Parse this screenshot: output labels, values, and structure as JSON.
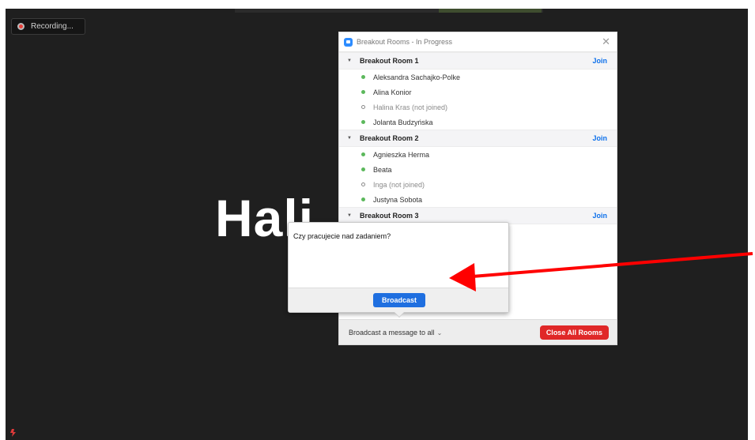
{
  "recording": {
    "label": "Recording..."
  },
  "speaker_name": "Hali",
  "panel": {
    "title": "Breakout Rooms - In Progress",
    "rooms": [
      {
        "name": "Breakout Room 1",
        "join": "Join",
        "members": [
          {
            "name": "Aleksandra Sachajko-Polke",
            "joined": true
          },
          {
            "name": "Alina Konior",
            "joined": true
          },
          {
            "name": "Halina Kras (not joined)",
            "joined": false
          },
          {
            "name": "Jolanta Budzyńska",
            "joined": true
          }
        ]
      },
      {
        "name": "Breakout Room 2",
        "join": "Join",
        "members": [
          {
            "name": "Agnieszka Herma",
            "joined": true
          },
          {
            "name": "Beata",
            "joined": true
          },
          {
            "name": "Inga (not joined)",
            "joined": false
          },
          {
            "name": "Justyna Sobota",
            "joined": true
          }
        ]
      },
      {
        "name": "Breakout Room 3",
        "join": "Join",
        "members": []
      }
    ],
    "broadcast_all": "Broadcast a message to all",
    "close_all": "Close All Rooms"
  },
  "popup": {
    "message": "Czy pracujecie nad zadaniem?",
    "broadcast_button": "Broadcast"
  },
  "colors": {
    "join": "#0e71eb",
    "close_all": "#e02828",
    "broadcast": "#1f6fe0",
    "arrow": "#ff0000",
    "online_dot": "#5cb85c"
  }
}
